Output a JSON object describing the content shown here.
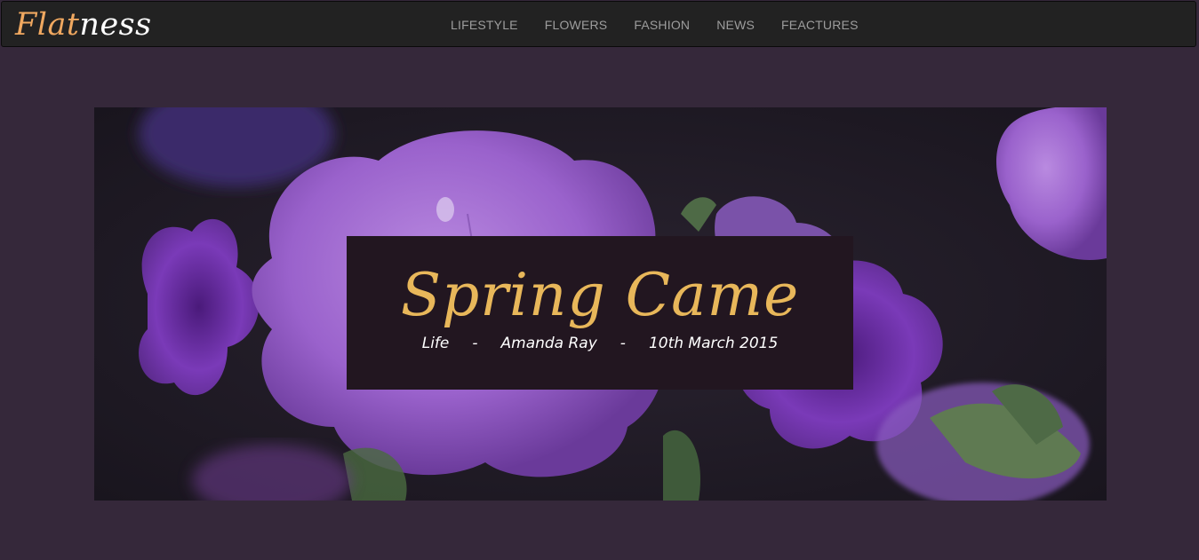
{
  "brand": {
    "part1": "Flat",
    "part2": "ness"
  },
  "nav": {
    "items": [
      {
        "label": "LIFESTYLE"
      },
      {
        "label": "FLOWERS"
      },
      {
        "label": "FASHION"
      },
      {
        "label": "NEWS"
      },
      {
        "label": "FEACTURES"
      }
    ]
  },
  "hero": {
    "title": "Spring Came",
    "category": "Life",
    "separator": "-",
    "author": "Amanda Ray",
    "date": "10th March 2015"
  },
  "colors": {
    "page_background": "#35283a",
    "navbar_background": "#222222",
    "brand_accent": "#f0a860",
    "title_color": "#e8b75a",
    "caption_background": "#221620",
    "flower_purple": "#9b5fcf"
  },
  "image": {
    "subject": "purple-petunia-flowers-photo"
  }
}
